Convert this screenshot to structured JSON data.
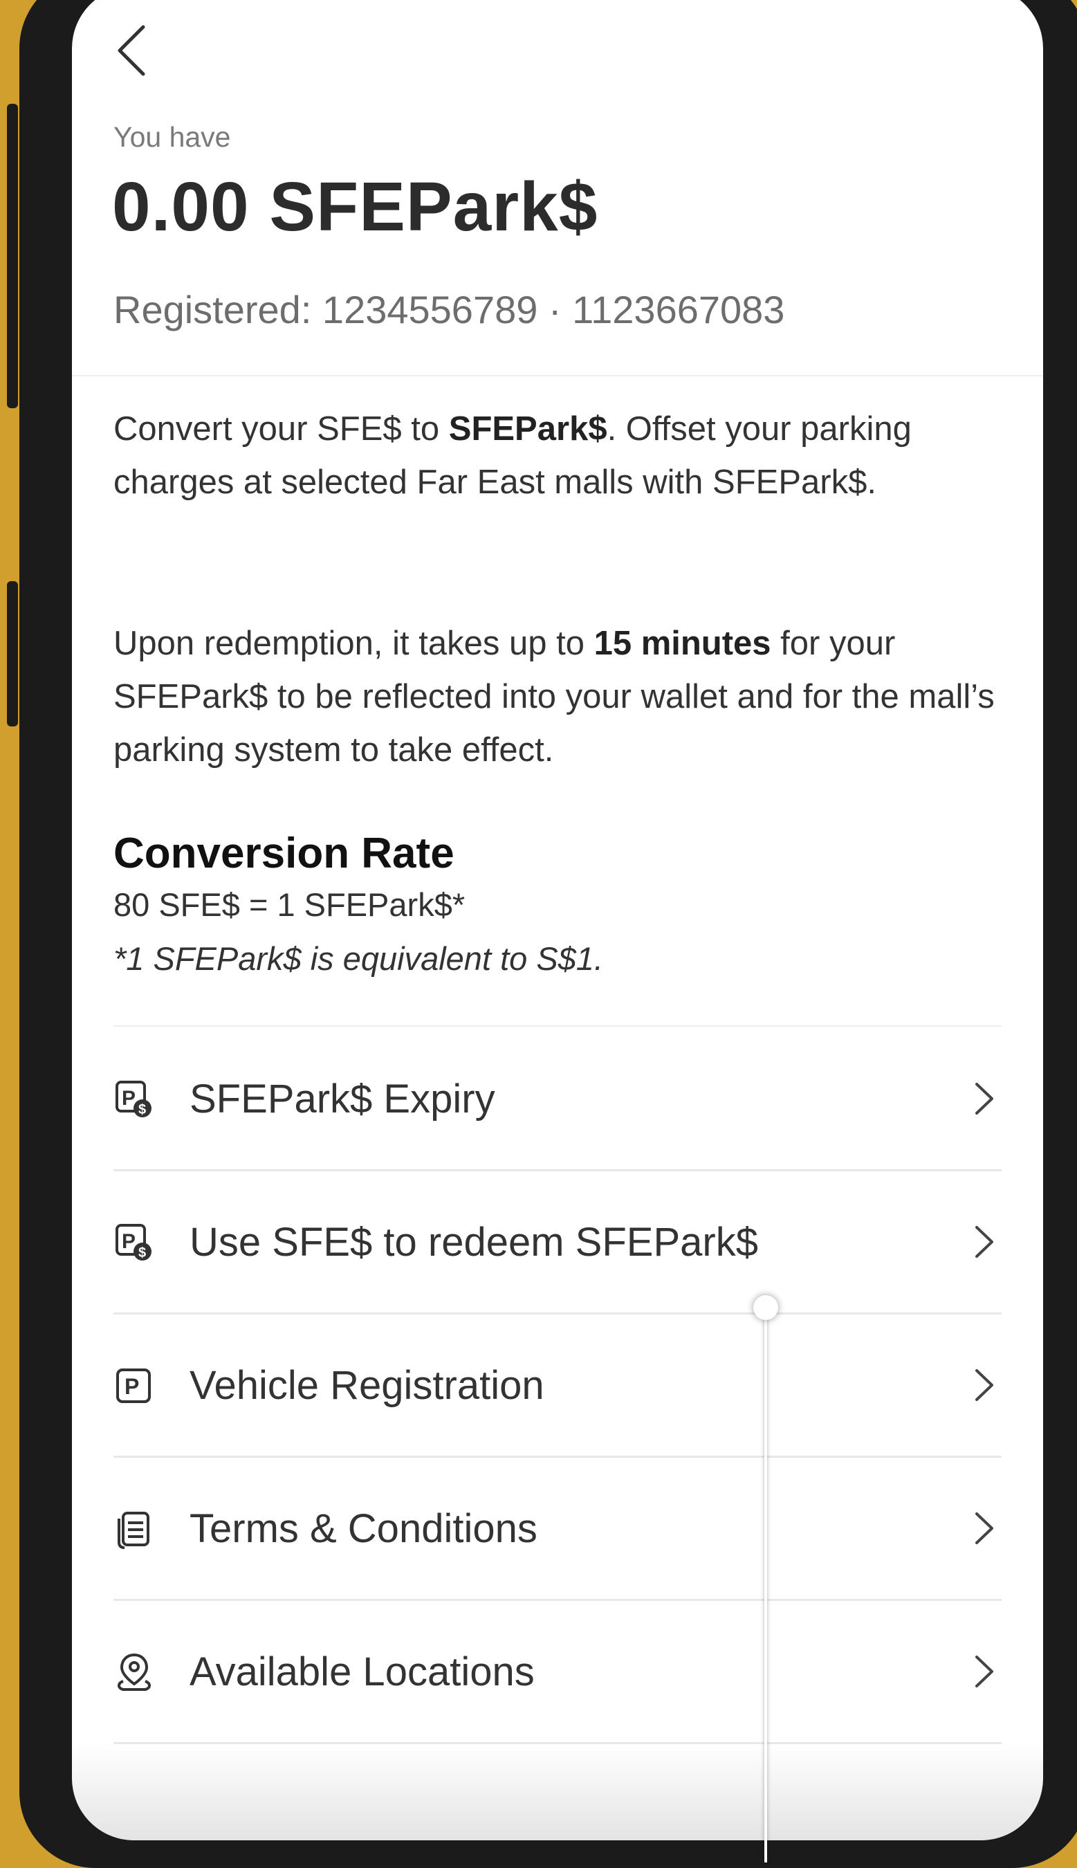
{
  "header": {
    "back_icon": "chevron-left-icon"
  },
  "balance": {
    "caption": "You have",
    "amount": "0.00 SFEPark$",
    "registered": "Registered: 1234556789 · 1123667083"
  },
  "info": {
    "para1_part1": "Convert your SFE$ to ",
    "para1_bold": "SFEPark$",
    "para1_part2": ". Offset your parking charges at selected Far East malls with SFEPark$.",
    "para2_part1": "Upon redemption, it takes up to ",
    "para2_bold": "15 minutes",
    "para2_part2": " for your SFEPark$ to be reflected into your wallet and for the mall’s parking system to take effect."
  },
  "conversion": {
    "title": "Conversion Rate",
    "rate": "80 SFE$ = 1 SFEPark$*",
    "note": "*1 SFEPark$ is equivalent to S$1."
  },
  "menu": {
    "items": [
      {
        "label": "SFEPark$ Expiry",
        "icon": "parking-dollar-icon"
      },
      {
        "label": "Use SFE$ to redeem SFEPark$",
        "icon": "parking-dollar-icon"
      },
      {
        "label": "Vehicle Registration",
        "icon": "parking-icon"
      },
      {
        "label": "Terms & Conditions",
        "icon": "document-icon"
      },
      {
        "label": "Available Locations",
        "icon": "location-icon"
      }
    ]
  },
  "colors": {
    "background": "#d19f2e",
    "text_primary": "#333333",
    "text_muted": "#7a7a7a"
  }
}
